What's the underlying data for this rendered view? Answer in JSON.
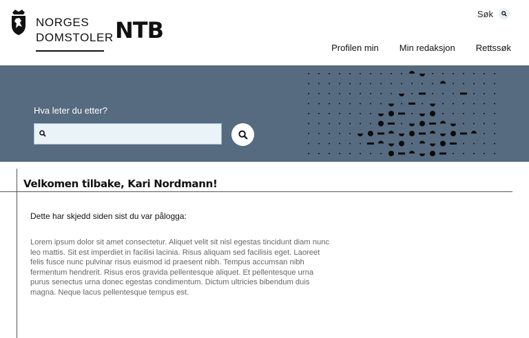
{
  "header": {
    "brand_line1": "NORGES",
    "brand_line2": "DOMSTOLER",
    "partner_logo": "NTB",
    "search_label": "Søk",
    "nav": [
      {
        "label": "Profilen min"
      },
      {
        "label": "Min redaksjon"
      },
      {
        "label": "Rettssøk"
      }
    ]
  },
  "hero": {
    "label": "Hva leter du etter?",
    "search_value": "",
    "search_placeholder": ""
  },
  "main": {
    "welcome": "Velkomen tilbake, Kari Nordmann!",
    "since_heading": "Dette har skjedd siden sist du var pålogga:",
    "body_text": "Lorem ipsum dolor sit amet consectetur. Aliquet velit sit nisl egestas tincidunt diam nunc leo mattis. Sit est imperdiet in facilisi lacinia. Risus aliquam sed facilisis eget. Laoreet felis fusce nunc pulvinar risus euismod id praesent nibh. Tempus accumsan nibh fermentum hendrerit. Risus eros gravida pellentesque aliquet. Et pellentesque urna purus senectus urna donec egestas condimentum. Dictum ultricies bibendum duis magna. Neque lacus pellentesque tempus est."
  },
  "colors": {
    "hero_bg": "#566a80",
    "search_bg": "#eaf3f7",
    "text": "#111111"
  },
  "icons": [
    "coat-of-arms-icon",
    "search-icon"
  ]
}
